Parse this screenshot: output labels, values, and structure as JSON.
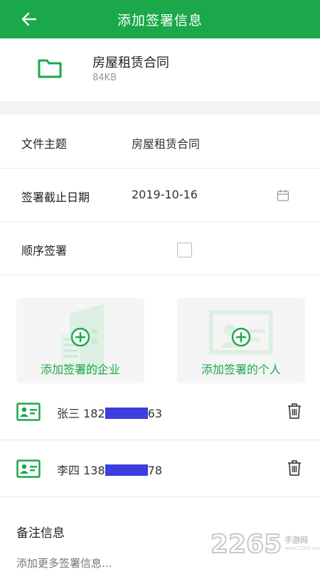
{
  "header": {
    "title": "添加签署信息",
    "back_icon": "arrow-left-icon"
  },
  "file": {
    "name": "房屋租赁合同",
    "size": "84KB",
    "icon": "folder-icon"
  },
  "form": {
    "subject_label": "文件主题",
    "subject_value": "房屋租赁合同",
    "deadline_label": "签署截止日期",
    "deadline_value": "2019-10-16",
    "order_label": "顺序签署",
    "order_checked": false
  },
  "actions": {
    "add_company": "添加签署的企业",
    "add_person": "添加签署的个人"
  },
  "signers": [
    {
      "name_prefix": "张三 182",
      "phone_suffix": "63"
    },
    {
      "name_prefix": "李四 138",
      "phone_suffix": "78"
    }
  ],
  "remark": {
    "title": "备注信息",
    "placeholder": "添加更多签署信息..."
  },
  "watermark": {
    "number": "2265",
    "sub": "手游网",
    "url": "www.2265.com"
  },
  "colors": {
    "accent": "#1aa84a",
    "redaction": "#3d3de0"
  }
}
